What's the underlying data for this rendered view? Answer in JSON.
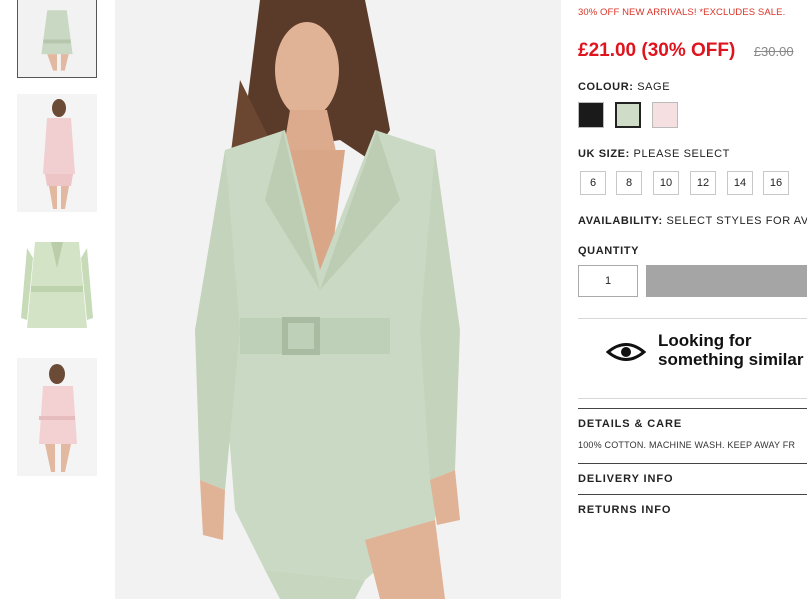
{
  "thumbnails": [
    {
      "alt": "sage playsuit front",
      "active": true
    },
    {
      "alt": "pink playsuit back",
      "active": false
    },
    {
      "alt": "sage blazer flat",
      "active": false
    },
    {
      "alt": "pink playsuit front",
      "active": false
    }
  ],
  "product": {
    "promo": "30% OFF NEW ARRIVALS! *EXCLUDES SALE.",
    "price_now": "£21.00 (30% OFF)",
    "price_was": "£30.00",
    "colour_label": "COLOUR:",
    "colour_value": "SAGE",
    "colours": [
      {
        "name": "black",
        "hex": "#1a1a1a",
        "selected": false
      },
      {
        "name": "sage",
        "hex": "#cfdcc8",
        "selected": true
      },
      {
        "name": "pink",
        "hex": "#f6dfe0",
        "selected": false
      }
    ],
    "size_label": "UK SIZE:",
    "size_value": "PLEASE SELECT",
    "sizes": [
      "6",
      "8",
      "10",
      "12",
      "14",
      "16"
    ],
    "availability_label": "AVAILABILITY:",
    "availability_value": "SELECT STYLES FOR AVAIL",
    "quantity_label": "QUANTITY",
    "quantity_value": "1",
    "similar_line1": "Looking for",
    "similar_line2": "something similar",
    "details_title": "DETAILS & CARE",
    "details_text": "100% COTTON. MACHINE WASH. KEEP AWAY FR",
    "delivery_title": "DELIVERY INFO",
    "returns_title": "RETURNS INFO"
  },
  "colors": {
    "accent_red": "#e0141e",
    "promo_red": "#d9352a",
    "button_grey": "#a5a5a5",
    "sage": "#cfdcc8"
  }
}
